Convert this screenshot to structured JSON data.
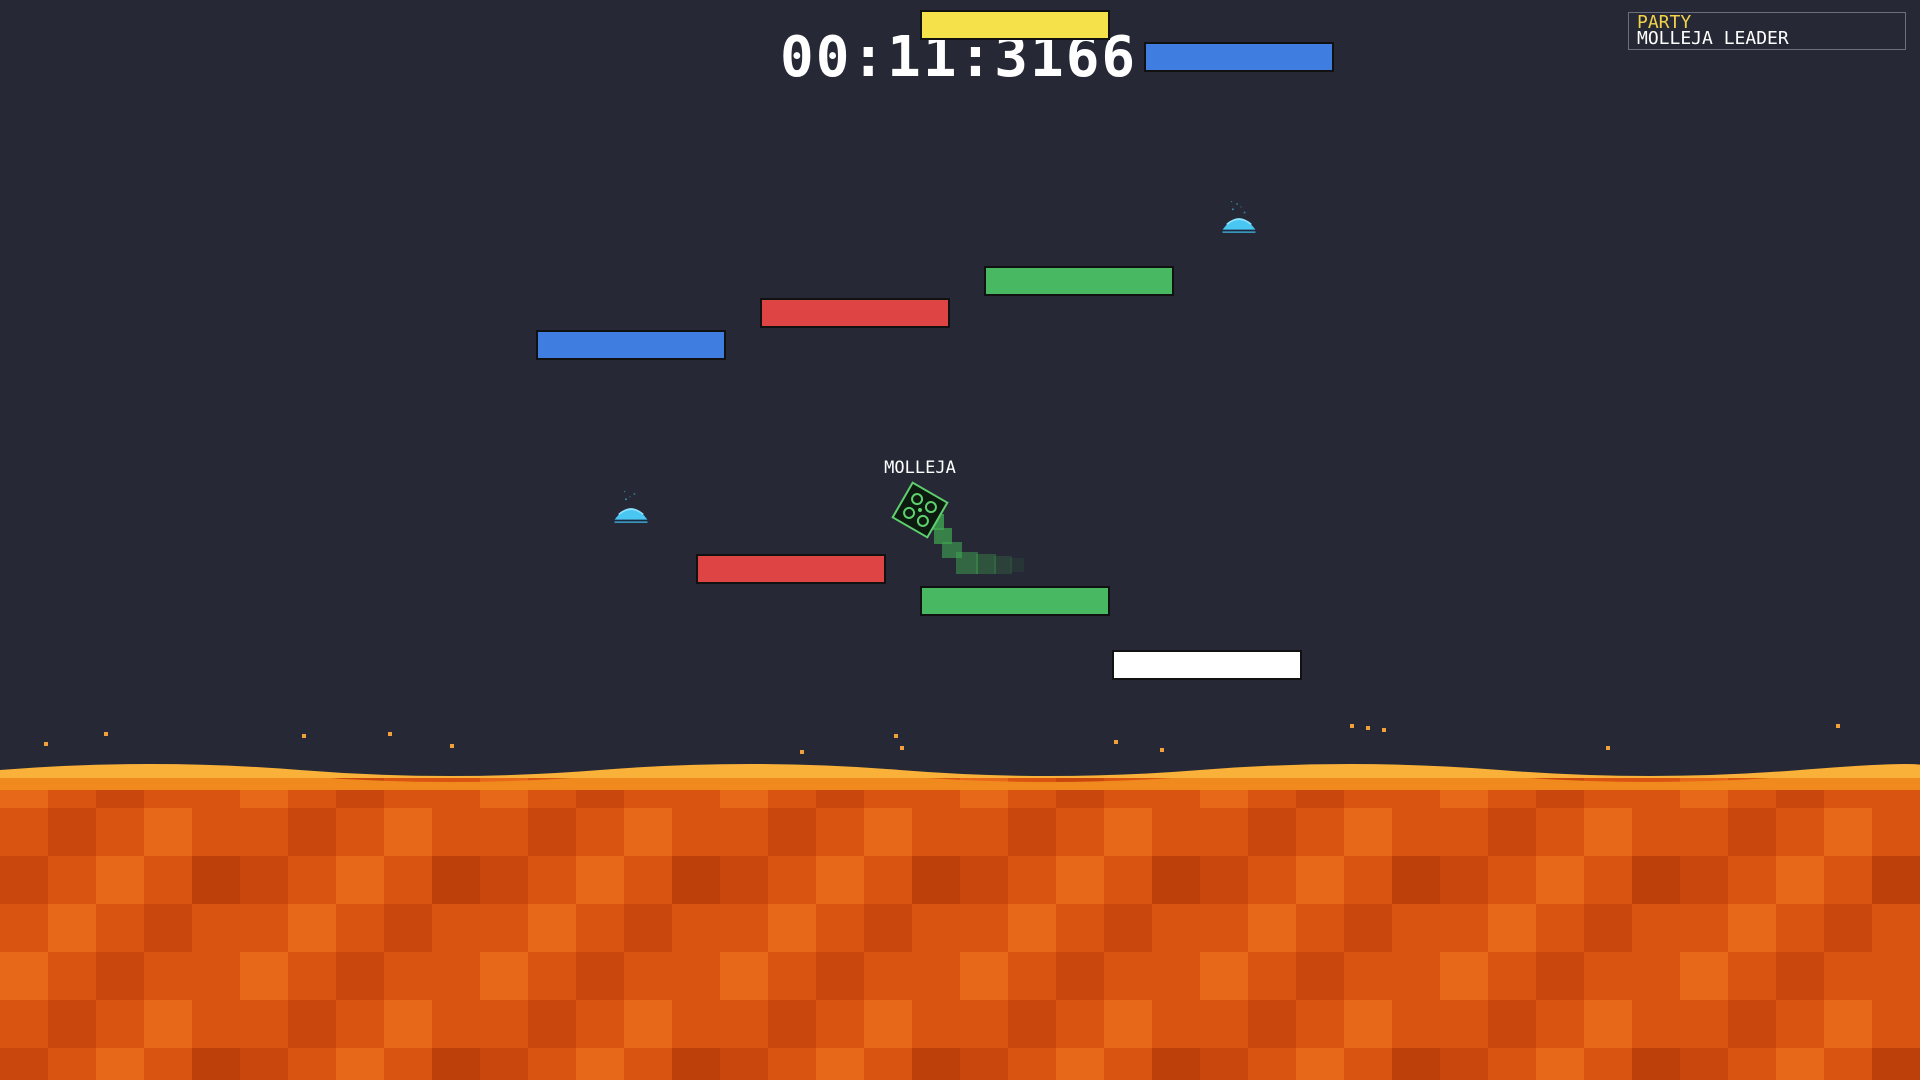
{
  "hud": {
    "timer": "00:11:3166"
  },
  "party": {
    "title": "PARTY",
    "members": [
      "MOLLEJA LEADER"
    ]
  },
  "player": {
    "name": "MOLLEJA"
  },
  "colors": {
    "background": "#262935",
    "platform_yellow": "#f5e14a",
    "platform_blue": "#3f7ee0",
    "platform_red": "#de4444",
    "platform_green": "#49b862",
    "platform_white": "#ffffff",
    "bounce_pad": "#49c6f2",
    "player_trail": "#3fa651",
    "lava": "#e35f12"
  },
  "platforms": [
    {
      "color": "yellow"
    },
    {
      "color": "blue"
    },
    {
      "color": "green"
    },
    {
      "color": "red"
    },
    {
      "color": "blue"
    },
    {
      "color": "red"
    },
    {
      "color": "green"
    },
    {
      "color": "white"
    }
  ],
  "bounce_pads": [
    {
      "icon": "bounce-pad-icon"
    },
    {
      "icon": "bounce-pad-icon"
    }
  ]
}
